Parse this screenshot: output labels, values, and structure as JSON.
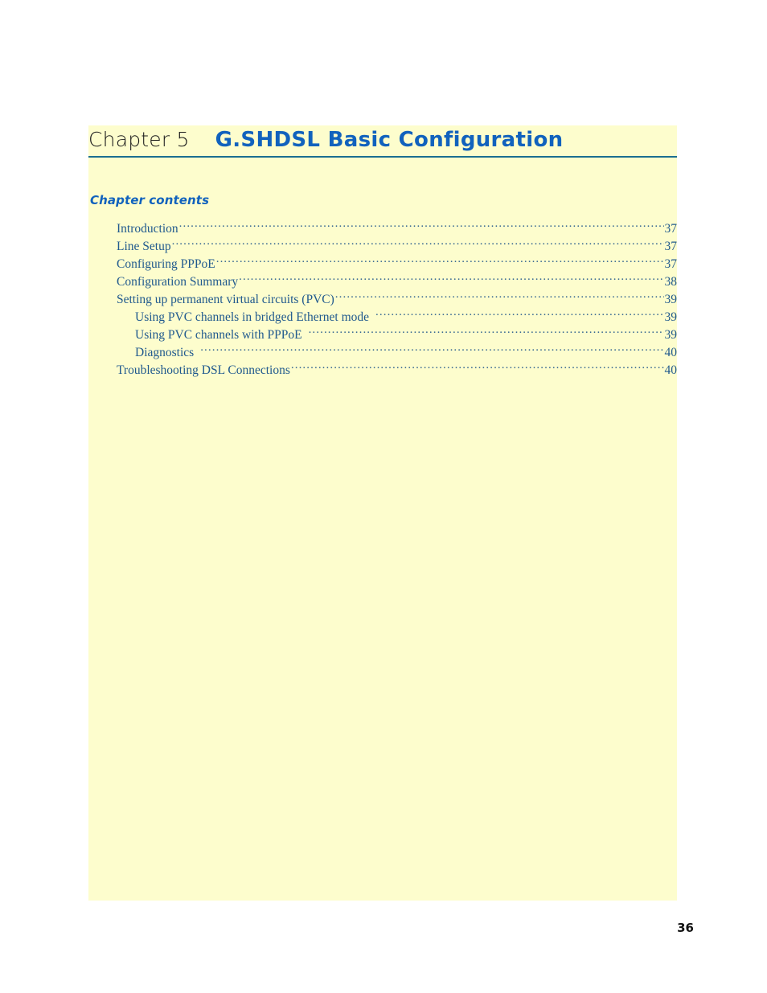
{
  "page": {
    "folio": "36",
    "panel_color": "#fdfdcd",
    "accent_color": "#1162bd",
    "rule_color": "#1c6f91",
    "toc_text_color": "#215a8e"
  },
  "header": {
    "chapter_label": "Chapter 5",
    "chapter_title": "G.SHDSL Basic Configuration"
  },
  "contents": {
    "heading": "Chapter contents",
    "entries": [
      {
        "label": "Introduction",
        "page": "37",
        "level": 1,
        "gap": false
      },
      {
        "label": "Line Setup",
        "page": "37",
        "level": 1,
        "gap": false
      },
      {
        "label": "Configuring PPPoE",
        "page": "37",
        "level": 1,
        "gap": false
      },
      {
        "label": "Configuration Summary",
        "page": "38",
        "level": 1,
        "gap": false
      },
      {
        "label": "Setting up permanent virtual circuits (PVC)",
        "page": "39",
        "level": 1,
        "gap": false
      },
      {
        "label": "Using PVC channels in bridged Ethernet mode",
        "page": "39",
        "level": 2,
        "gap": true
      },
      {
        "label": "Using PVC channels with PPPoE",
        "page": "39",
        "level": 2,
        "gap": true
      },
      {
        "label": "Diagnostics",
        "page": "40",
        "level": 2,
        "gap": true
      },
      {
        "label": "Troubleshooting DSL Connections",
        "page": "40",
        "level": 1,
        "gap": false
      }
    ]
  }
}
